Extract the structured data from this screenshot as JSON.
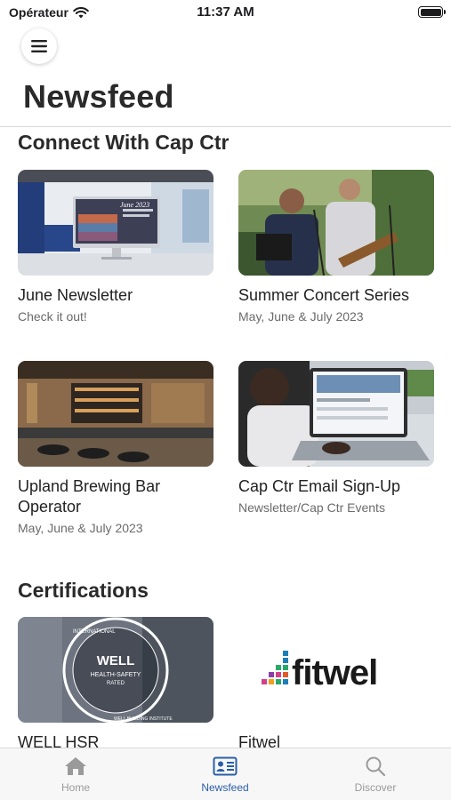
{
  "status_bar": {
    "carrier": "Opérateur",
    "time": "11:37 AM"
  },
  "header": {
    "title": "Newsfeed",
    "menu_icon": "hamburger-menu-icon"
  },
  "sections": [
    {
      "title": "Connect With Cap Ctr",
      "cards": [
        {
          "title": "June Newsletter",
          "subtitle": "Check it out!",
          "image": "office-lobby-monitor",
          "image_text": "June 2023"
        },
        {
          "title": "Summer Concert Series",
          "subtitle": "May, June & July 2023",
          "image": "outdoor-band"
        },
        {
          "title": "Upland Brewing Bar Operator",
          "subtitle": "May, June & July 2023",
          "image": "bar-interior"
        },
        {
          "title": "Cap Ctr Email Sign-Up",
          "subtitle": "Newsletter/Cap Ctr Events",
          "image": "laptop-typing"
        }
      ]
    },
    {
      "title": "Certifications",
      "cards": [
        {
          "title": "WELL HSR",
          "image": "well-seal",
          "seal_main": "WELL",
          "seal_line1": "HEALTH-SAFETY",
          "seal_line2": "RATED",
          "seal_ring_top": "INTERNATIONAL",
          "seal_ring_bottom": "WELL BUILDING INSTITUTE"
        },
        {
          "title": "Fitwel",
          "image": "fitwel-logo",
          "logo_text": "fitwel"
        }
      ]
    }
  ],
  "tab_bar": {
    "tabs": [
      {
        "label": "Home",
        "icon": "home-icon",
        "active": false
      },
      {
        "label": "Newsfeed",
        "icon": "newsfeed-icon",
        "active": true
      },
      {
        "label": "Discover",
        "icon": "search-icon",
        "active": false
      }
    ]
  },
  "colors": {
    "accent": "#2a5ea8",
    "inactive": "#9a9a9a",
    "text": "#222222",
    "subtitle": "#6b6b6b"
  }
}
